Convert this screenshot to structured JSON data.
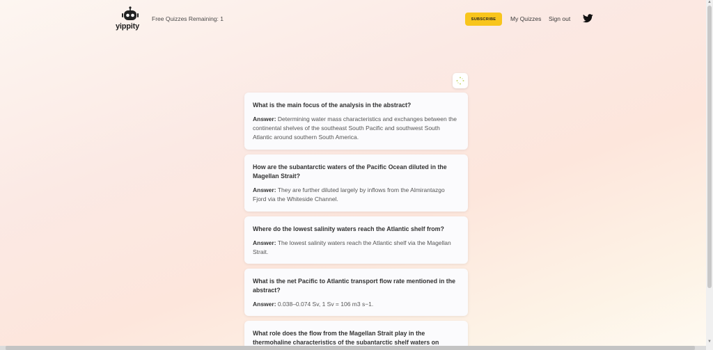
{
  "header": {
    "logo_text": "yippity",
    "free_quizzes": "Free Quizzes Remaining: 1",
    "subscribe_label": "SUBSCRIBE",
    "my_quizzes_label": "My Quizzes",
    "sign_out_label": "Sign out"
  },
  "colors": {
    "accent": "#f8c51c"
  },
  "answer_prefix": "Answer:",
  "cards": [
    {
      "question": "What is the main focus of the analysis in the abstract?",
      "answer": "Determining water mass characteristics and exchanges between the continental shelves of the southeast South Pacific and southwest South Atlantic around southern South America."
    },
    {
      "question": "How are the subantarctic waters of the Pacific Ocean diluted in the Magellan Strait?",
      "answer": "They are further diluted largely by inflows from the Almirantazgo Fjord via the Whiteside Channel."
    },
    {
      "question": "Where do the lowest salinity waters reach the Atlantic shelf from?",
      "answer": "The lowest salinity waters reach the Atlantic shelf via the Magellan Strait."
    },
    {
      "question": "What is the net Pacific to Atlantic transport flow rate mentioned in the abstract?",
      "answer": "0.038–0.074 Sv, 1 Sv = 106 m3 s−1."
    },
    {
      "question": "What role does the flow from the Magellan Strait play in the thermohaline characteristics of the subantarctic shelf waters on",
      "answer": ""
    }
  ]
}
